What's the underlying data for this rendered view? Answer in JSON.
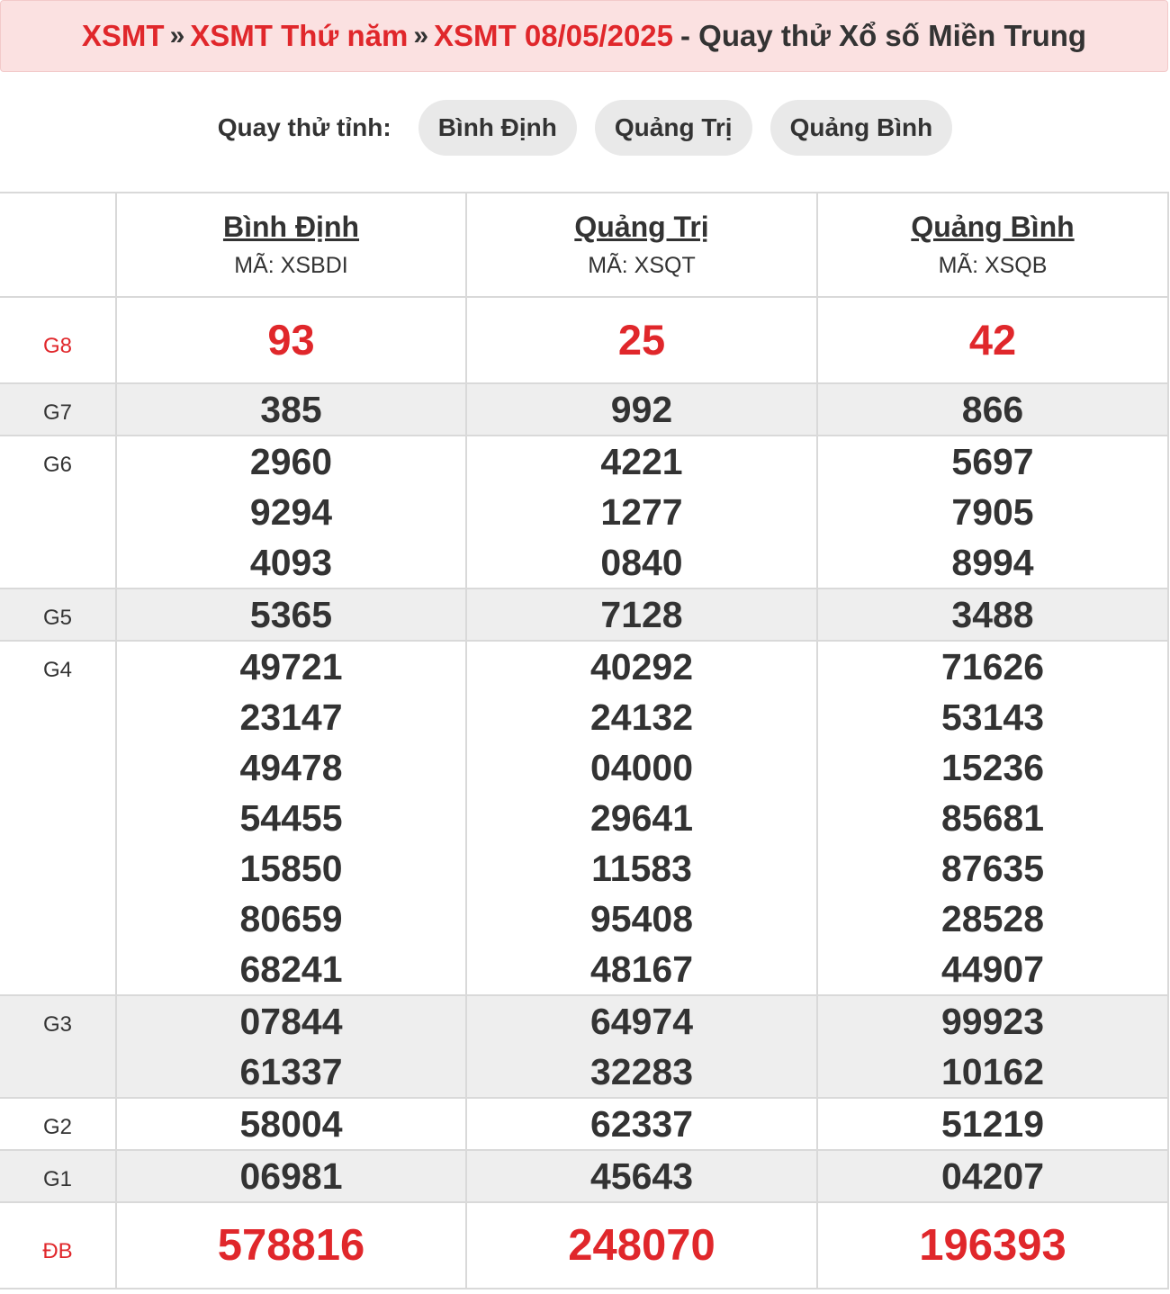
{
  "title": {
    "crumb1": "XSMT",
    "crumb2": "XSMT Thứ năm",
    "crumb3": "XSMT 08/05/2025",
    "separator": "»",
    "rest": "- Quay thử Xổ số Miền Trung"
  },
  "chooser": {
    "label": "Quay thử tỉnh:",
    "options": [
      "Bình Định",
      "Quảng Trị",
      "Quảng Bình"
    ]
  },
  "provinces": [
    {
      "name": "Bình Định",
      "code": "MÃ: XSBDI"
    },
    {
      "name": "Quảng Trị",
      "code": "MÃ: XSQT"
    },
    {
      "name": "Quảng Bình",
      "code": "MÃ: XSQB"
    }
  ],
  "prizes": [
    {
      "label": "G8",
      "values": [
        [
          "93"
        ],
        [
          "25"
        ],
        [
          "42"
        ]
      ]
    },
    {
      "label": "G7",
      "values": [
        [
          "385"
        ],
        [
          "992"
        ],
        [
          "866"
        ]
      ]
    },
    {
      "label": "G6",
      "values": [
        [
          "2960",
          "9294",
          "4093"
        ],
        [
          "4221",
          "1277",
          "0840"
        ],
        [
          "5697",
          "7905",
          "8994"
        ]
      ]
    },
    {
      "label": "G5",
      "values": [
        [
          "5365"
        ],
        [
          "7128"
        ],
        [
          "3488"
        ]
      ]
    },
    {
      "label": "G4",
      "values": [
        [
          "49721",
          "23147",
          "49478",
          "54455",
          "15850",
          "80659",
          "68241"
        ],
        [
          "40292",
          "24132",
          "04000",
          "29641",
          "11583",
          "95408",
          "48167"
        ],
        [
          "71626",
          "53143",
          "15236",
          "85681",
          "87635",
          "28528",
          "44907"
        ]
      ]
    },
    {
      "label": "G3",
      "values": [
        [
          "07844",
          "61337"
        ],
        [
          "64974",
          "32283"
        ],
        [
          "99923",
          "10162"
        ]
      ]
    },
    {
      "label": "G2",
      "values": [
        [
          "58004"
        ],
        [
          "62337"
        ],
        [
          "51219"
        ]
      ]
    },
    {
      "label": "G1",
      "values": [
        [
          "06981"
        ],
        [
          "45643"
        ],
        [
          "04207"
        ]
      ]
    },
    {
      "label": "ĐB",
      "values": [
        [
          "578816"
        ],
        [
          "248070"
        ],
        [
          "196393"
        ]
      ]
    }
  ]
}
